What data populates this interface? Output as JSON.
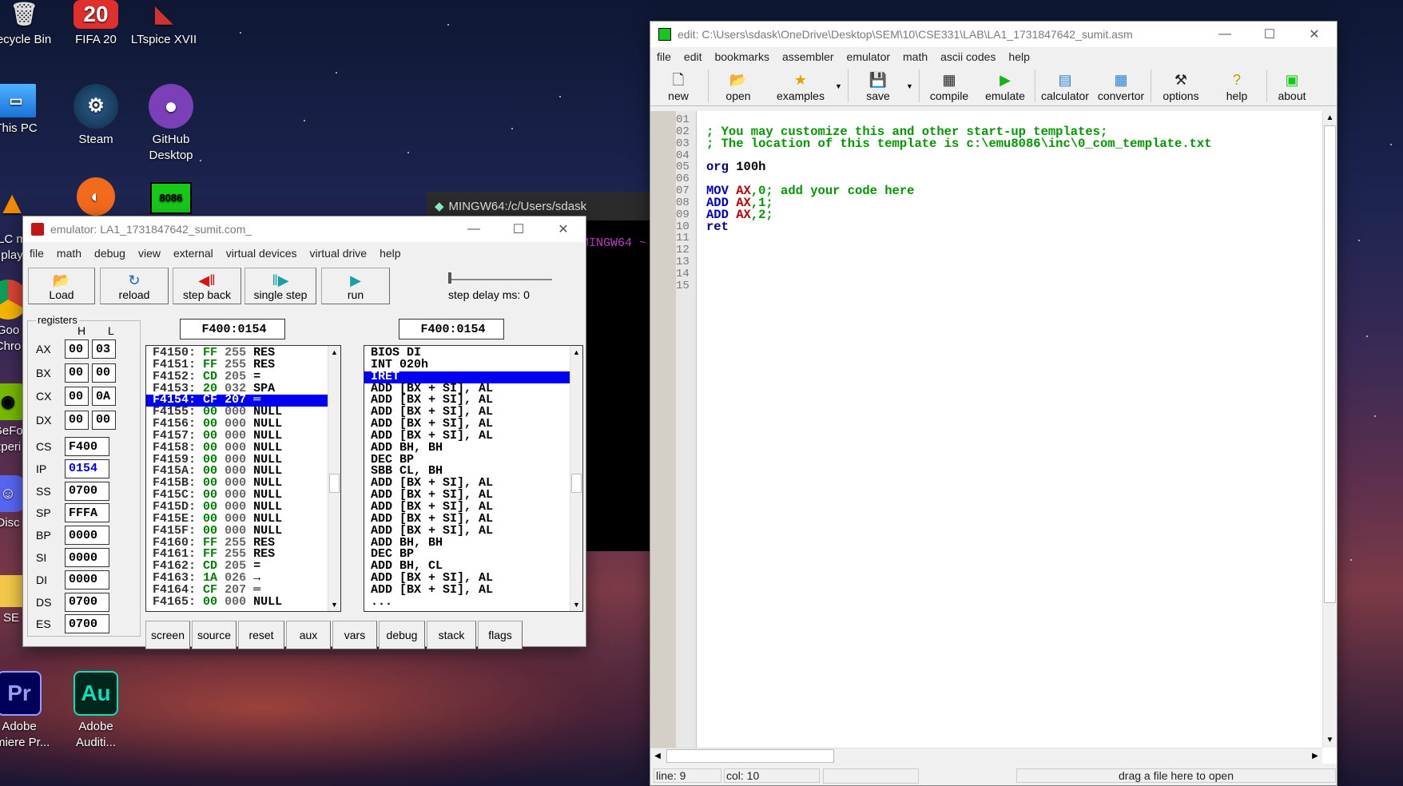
{
  "desktop": {
    "icons": [
      {
        "label": "ecycle Bin"
      },
      {
        "label": "FIFA 20",
        "glyph": "20"
      },
      {
        "label": "LTspice XVII"
      },
      {
        "label": "This PC"
      },
      {
        "label": "Steam"
      },
      {
        "label": "GitHub\nDesktop"
      },
      {
        "label": "8086"
      },
      {
        "label": "LC m\nplay"
      },
      {
        "label": "Goo\nChro"
      },
      {
        "label": "GeFo\nxperi"
      },
      {
        "label": "Disc"
      },
      {
        "label": "SE"
      },
      {
        "label": "Adobe\nemiere Pr...",
        "glyph": "Pr"
      },
      {
        "label": "Adobe\nAuditi...",
        "glyph": "Au"
      }
    ]
  },
  "terminal": {
    "title": "MINGW64:/c/Users/sdask",
    "prompt": "MINGW64 ~"
  },
  "editor": {
    "title": "edit: C:\\Users\\sdask\\OneDrive\\Desktop\\SEM\\10\\CSE331\\LAB\\LA1_1731847642_sumit.asm",
    "menu": [
      "file",
      "edit",
      "bookmarks",
      "assembler",
      "emulator",
      "math",
      "ascii codes",
      "help"
    ],
    "toolbar": [
      {
        "label": "new",
        "icon": "new-icon"
      },
      {
        "label": "open",
        "icon": "open-icon"
      },
      {
        "label": "examples",
        "icon": "examples-icon"
      },
      {
        "label": "save",
        "icon": "save-icon"
      },
      {
        "label": "compile",
        "icon": "compile-icon"
      },
      {
        "label": "emulate",
        "icon": "emulate-icon"
      },
      {
        "label": "calculator",
        "icon": "calculator-icon"
      },
      {
        "label": "convertor",
        "icon": "convertor-icon"
      },
      {
        "label": "options",
        "icon": "options-icon"
      },
      {
        "label": "help",
        "icon": "help-icon"
      },
      {
        "label": "about",
        "icon": "about-icon"
      }
    ],
    "line_numbers": [
      "01",
      "02",
      "03",
      "04",
      "05",
      "06",
      "07",
      "08",
      "09",
      "10",
      "11",
      "12",
      "13",
      "14",
      "15"
    ],
    "code": [
      [],
      [
        {
          "t": "; You may customize this and other start-up templates;",
          "c": "#009900"
        }
      ],
      [
        {
          "t": "; The location of this template is c:\\emu8086\\inc\\0_com_template.txt",
          "c": "#009900"
        }
      ],
      [],
      [
        {
          "t": "org ",
          "c": "#00008b"
        },
        {
          "t": "100h",
          "c": "#000000"
        }
      ],
      [],
      [
        {
          "t": "MOV ",
          "c": "#0000cc"
        },
        {
          "t": "AX",
          "c": "#c00000"
        },
        {
          "t": ",0; add your code here",
          "c": "#009900"
        }
      ],
      [
        {
          "t": "ADD ",
          "c": "#0000cc"
        },
        {
          "t": "AX",
          "c": "#c00000"
        },
        {
          "t": ",1;",
          "c": "#009900"
        }
      ],
      [
        {
          "t": "ADD ",
          "c": "#0000cc"
        },
        {
          "t": "AX",
          "c": "#c00000"
        },
        {
          "t": ",2;",
          "c": "#009900"
        }
      ],
      [
        {
          "t": "ret",
          "c": "#00008b"
        }
      ],
      [],
      [],
      [],
      [],
      []
    ],
    "status": {
      "line": "line: 9",
      "col": "col: 10",
      "drop_hint": "drag a file here to open"
    }
  },
  "emulator": {
    "title": "emulator: LA1_1731847642_sumit.com_",
    "menu": [
      "file",
      "math",
      "debug",
      "view",
      "external",
      "virtual devices",
      "virtual drive",
      "help"
    ],
    "buttons": [
      {
        "label": "Load",
        "icon": "load-icon"
      },
      {
        "label": "reload",
        "icon": "reload-icon"
      },
      {
        "label": "step back",
        "icon": "step-back-icon"
      },
      {
        "label": "single step",
        "icon": "single-step-icon"
      },
      {
        "label": "run",
        "icon": "run-icon"
      }
    ],
    "step_delay_label": "step delay ms: 0",
    "registers_label": "registers",
    "h_label": "H",
    "l_label": "L",
    "split_registers": [
      {
        "name": "AX",
        "h": "00",
        "l": "03"
      },
      {
        "name": "BX",
        "h": "00",
        "l": "00"
      },
      {
        "name": "CX",
        "h": "00",
        "l": "0A"
      },
      {
        "name": "DX",
        "h": "00",
        "l": "00"
      }
    ],
    "registers": [
      {
        "name": "CS",
        "value": "F400",
        "color": "#000000"
      },
      {
        "name": "IP",
        "value": "0154",
        "color": "#0000ff"
      },
      {
        "name": "SS",
        "value": "0700",
        "color": "#000000"
      },
      {
        "name": "SP",
        "value": "FFFA",
        "color": "#000000"
      },
      {
        "name": "BP",
        "value": "0000",
        "color": "#000000"
      },
      {
        "name": "SI",
        "value": "0000",
        "color": "#000000"
      },
      {
        "name": "DI",
        "value": "0000",
        "color": "#000000"
      },
      {
        "name": "DS",
        "value": "0700",
        "color": "#000000"
      },
      {
        "name": "ES",
        "value": "0700",
        "color": "#000000"
      }
    ],
    "memory_address": "F400:0154",
    "disasm_address": "F400:0154",
    "memory_selected_index": 4,
    "memory": [
      {
        "addr": "F4150:",
        "hex": "FF",
        "dec": "255",
        "chr": "RES"
      },
      {
        "addr": "F4151:",
        "hex": "FF",
        "dec": "255",
        "chr": "RES"
      },
      {
        "addr": "F4152:",
        "hex": "CD",
        "dec": "205",
        "chr": "="
      },
      {
        "addr": "F4153:",
        "hex": "20",
        "dec": "032",
        "chr": "SPA"
      },
      {
        "addr": "F4154:",
        "hex": "CF",
        "dec": "207",
        "chr": "═"
      },
      {
        "addr": "F4155:",
        "hex": "00",
        "dec": "000",
        "chr": "NULL"
      },
      {
        "addr": "F4156:",
        "hex": "00",
        "dec": "000",
        "chr": "NULL"
      },
      {
        "addr": "F4157:",
        "hex": "00",
        "dec": "000",
        "chr": "NULL"
      },
      {
        "addr": "F4158:",
        "hex": "00",
        "dec": "000",
        "chr": "NULL"
      },
      {
        "addr": "F4159:",
        "hex": "00",
        "dec": "000",
        "chr": "NULL"
      },
      {
        "addr": "F415A:",
        "hex": "00",
        "dec": "000",
        "chr": "NULL"
      },
      {
        "addr": "F415B:",
        "hex": "00",
        "dec": "000",
        "chr": "NULL"
      },
      {
        "addr": "F415C:",
        "hex": "00",
        "dec": "000",
        "chr": "NULL"
      },
      {
        "addr": "F415D:",
        "hex": "00",
        "dec": "000",
        "chr": "NULL"
      },
      {
        "addr": "F415E:",
        "hex": "00",
        "dec": "000",
        "chr": "NULL"
      },
      {
        "addr": "F415F:",
        "hex": "00",
        "dec": "000",
        "chr": "NULL"
      },
      {
        "addr": "F4160:",
        "hex": "FF",
        "dec": "255",
        "chr": "RES"
      },
      {
        "addr": "F4161:",
        "hex": "FF",
        "dec": "255",
        "chr": "RES"
      },
      {
        "addr": "F4162:",
        "hex": "CD",
        "dec": "205",
        "chr": "="
      },
      {
        "addr": "F4163:",
        "hex": "1A",
        "dec": "026",
        "chr": "→"
      },
      {
        "addr": "F4164:",
        "hex": "CF",
        "dec": "207",
        "chr": "═"
      },
      {
        "addr": "F4165:",
        "hex": "00",
        "dec": "000",
        "chr": "NULL"
      }
    ],
    "disasm_selected_index": 2,
    "disasm": [
      "BIOS DI",
      "INT 020h",
      "IRET",
      "ADD [BX + SI], AL",
      "ADD [BX + SI], AL",
      "ADD [BX + SI], AL",
      "ADD [BX + SI], AL",
      "ADD [BX + SI], AL",
      "ADD BH, BH",
      "DEC BP",
      "SBB CL, BH",
      "ADD [BX + SI], AL",
      "ADD [BX + SI], AL",
      "ADD [BX + SI], AL",
      "ADD [BX + SI], AL",
      "ADD [BX + SI], AL",
      "ADD BH, BH",
      "DEC BP",
      "ADD BH, CL",
      "ADD [BX + SI], AL",
      "ADD [BX + SI], AL",
      "..."
    ],
    "bottom_buttons": [
      "screen",
      "source",
      "reset",
      "aux",
      "vars",
      "debug",
      "stack",
      "flags"
    ]
  }
}
